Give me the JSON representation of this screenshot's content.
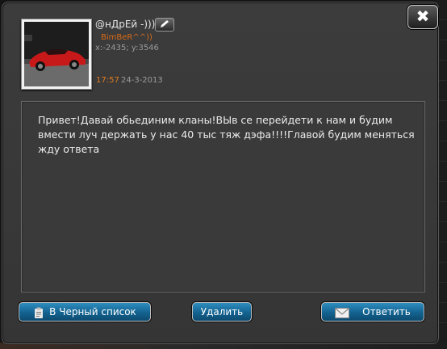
{
  "header": {
    "player_name": "@нДрЕй -)))",
    "clan_name": "BimBeR^^))",
    "coordinates": "x:-2435; y:3546",
    "time": "17:57",
    "date": "24-3-2013"
  },
  "close": {
    "label": "✖"
  },
  "message": {
    "text": "Привет!Давай обьединим кланы!ВЫв се перейдети к нам и будим вмести луч держать у нас 40 тыс тяж дэфа!!!!Главой будим меняться жду ответа"
  },
  "actions": {
    "blacklist_label": "В Черный список",
    "delete_label": "Удалить",
    "reply_label": "Ответить"
  },
  "icons": {
    "close": "close-icon",
    "edit": "pencil-icon",
    "blacklist": "clipboard-icon",
    "reply": "envelope-icon"
  },
  "colors": {
    "accent_orange": "#e07a1f",
    "button_blue": "#1a6f9f",
    "panel": "#3c3c3c"
  }
}
